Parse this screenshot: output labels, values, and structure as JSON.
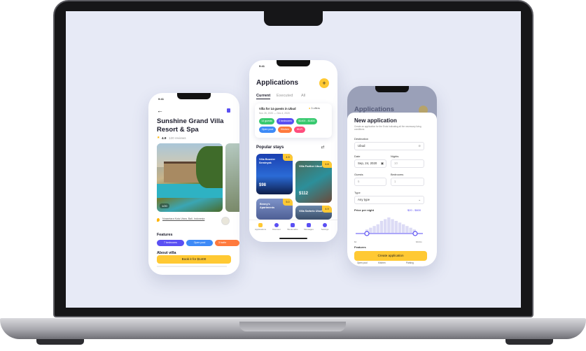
{
  "phone1": {
    "time": "9:41",
    "title_line1": "Sunshine Grand Villa",
    "title_line2": "Resort & Spa",
    "rating": "4.9",
    "reviews": "120 reviews",
    "photo_counter": "1/20",
    "address": "Nusantara Kuta Utara, Bali, Indonesia",
    "features_heading": "Features",
    "features": [
      "7 bedrooms",
      "Open pool",
      "3 bathr"
    ],
    "about_heading": "About villa",
    "book_button": "Book it for $1400"
  },
  "phone2": {
    "time": "9:41",
    "title": "Applications",
    "tabs": [
      "Current",
      "Executed",
      "All"
    ],
    "card_title": "Villa for 14 guests in Ubud",
    "card_offers": "3 offers",
    "card_dates": "Nov 26, 2020 — Dec 4, 2020",
    "card_chips": [
      "14 guests",
      "3 bedrooms",
      "$1400 - $1800",
      "Open pool",
      "Kitchen",
      "Wi-Fi"
    ],
    "popular_heading": "Popular stays",
    "stays": [
      {
        "name": "Villa Bouvier Seminyak",
        "price": "$98",
        "rating": "4.9"
      },
      {
        "name": "Villa Parther Ubud",
        "price": "$112",
        "rating": "4.8"
      },
      {
        "name": "Benny's Apartments",
        "price": "",
        "rating": "5.0"
      },
      {
        "name": "Villa Sarbelo Ubud",
        "price": "",
        "rating": "4.9"
      }
    ],
    "nav": [
      "Applications",
      "Discover",
      "Bookmarks",
      "Messages",
      "Settings"
    ]
  },
  "phone3": {
    "bg_title": "Applications",
    "title": "New application",
    "subtitle": "Create an application for the Ends Indicating all the necessary living conditions",
    "destination_label": "Destination",
    "destination_value": "Ubud",
    "date_label": "Date",
    "date_value": "Sep, 24, 2020",
    "nights_label": "Nights",
    "nights_value": "10",
    "guests_label": "Guests",
    "guests_value": "5",
    "bedrooms_label": "Bedrooms",
    "bedrooms_value": "1",
    "type_label": "Type",
    "type_value": "Any type",
    "price_label": "Price per night",
    "price_range": "$20 - $600",
    "min_label": "$0",
    "max_label": "$600m",
    "histogram": [
      2,
      3,
      4,
      5,
      7,
      8,
      9,
      8,
      7,
      6,
      5,
      4,
      3,
      2
    ],
    "features_label": "Features",
    "create_button": "Create application",
    "bottom_chips": [
      "Open pool",
      "Kitchen",
      "Parking"
    ]
  },
  "colors": {
    "accent": "#ffc933",
    "purple": "#5a4ff3",
    "blue": "#3d8af7",
    "green": "#38c96f",
    "orange": "#ff7a3d",
    "pink": "#ff4d7d",
    "text": "#1b1b2b"
  }
}
